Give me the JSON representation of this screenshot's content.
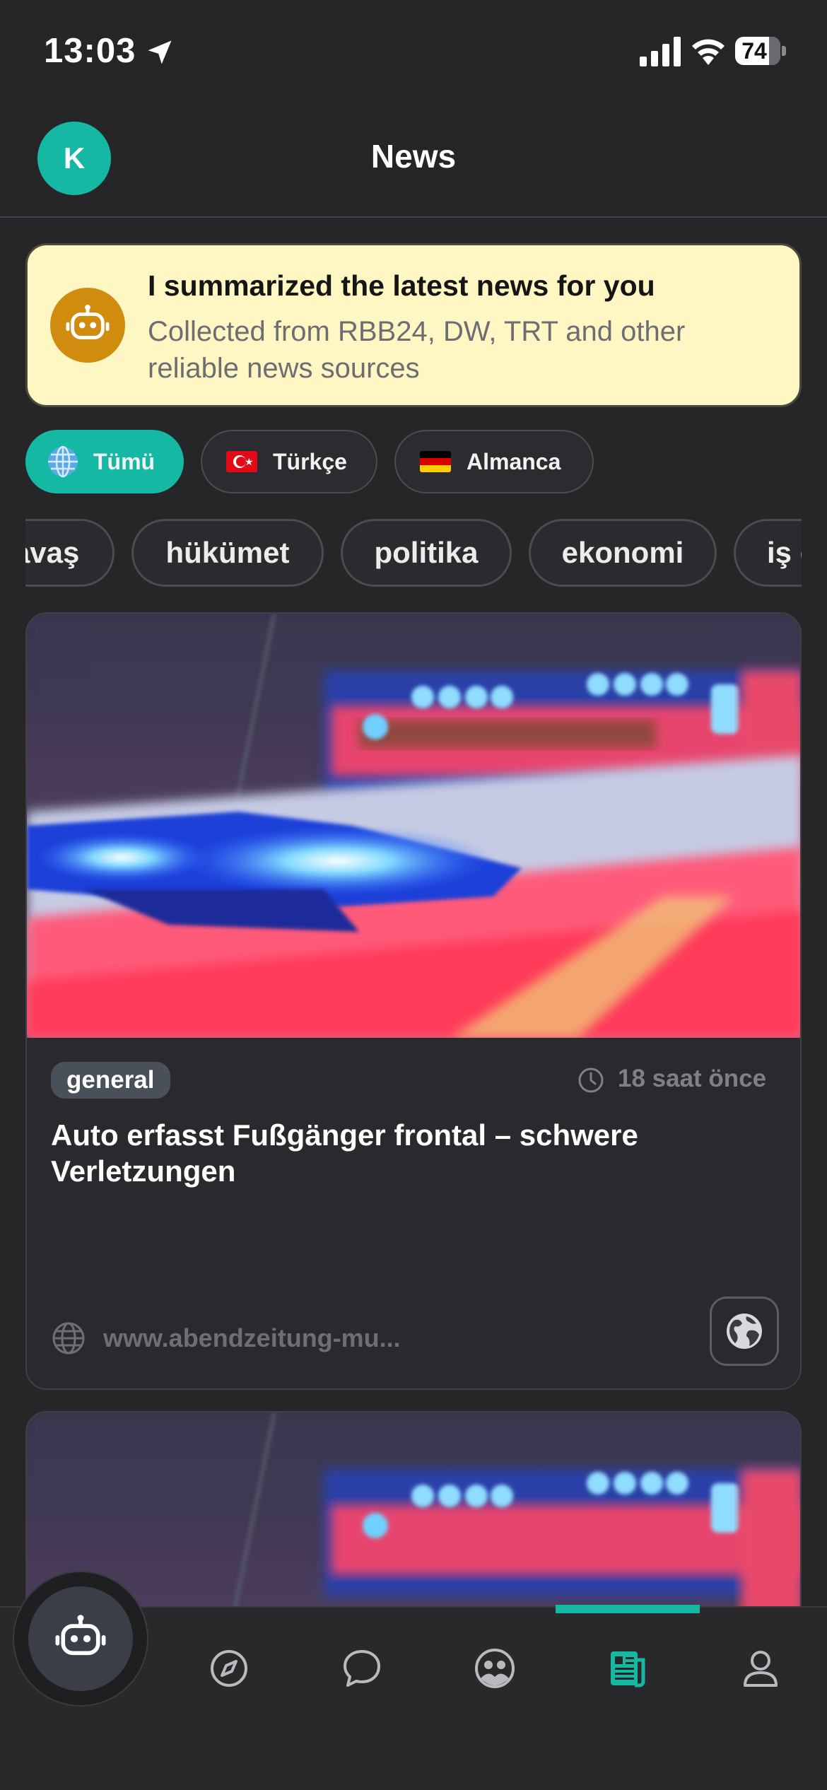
{
  "status_bar": {
    "time": "13:03",
    "battery": "74"
  },
  "header": {
    "avatar_initial": "K",
    "title": "News"
  },
  "banner": {
    "title": "I summarized the latest news for you",
    "subtitle": "Collected from RBB24, DW, TRT and other reliable news sources"
  },
  "language_filters": [
    {
      "label": "Tümü",
      "icon": "globe-icon",
      "active": true
    },
    {
      "label": "Türkçe",
      "icon": "turkey-flag-icon",
      "active": false
    },
    {
      "label": "Almanca",
      "icon": "germany-flag-icon",
      "active": false
    }
  ],
  "topics": [
    "savaş",
    "hükümet",
    "politika",
    "ekonomi",
    "iş dünyası"
  ],
  "articles": [
    {
      "category": "general",
      "time_ago": "18 saat önce",
      "title": "Auto erfasst Fußgänger frontal – schwere Verletzungen",
      "source": "www.abendzeitung-mu..."
    },
    {
      "category": "",
      "time_ago": "",
      "title": "",
      "source": ""
    }
  ],
  "bottom_nav": {
    "items": [
      "robot-assistant-icon",
      "compass-icon",
      "chat-bubble-icon",
      "community-icon",
      "newspaper-icon",
      "profile-icon"
    ],
    "active": "newspaper-icon"
  },
  "colors": {
    "accent": "#14b8a3",
    "banner_bg": "#fef6c3",
    "bot_circle": "#cf8c0e",
    "background": "#262629"
  }
}
